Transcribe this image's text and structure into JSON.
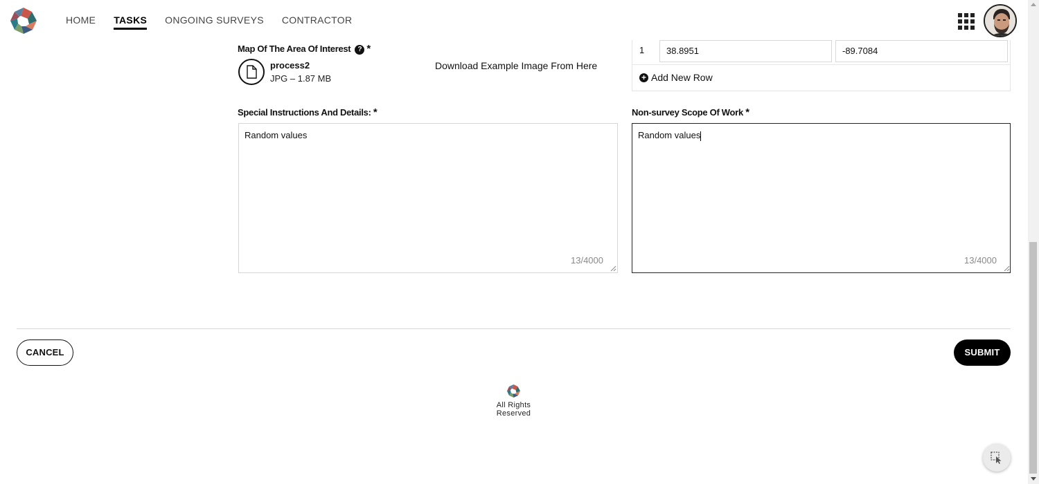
{
  "nav": {
    "items": [
      {
        "label": "HOME"
      },
      {
        "label": "TASKS"
      },
      {
        "label": "ONGOING SURVEYS"
      },
      {
        "label": "CONTRACTOR"
      }
    ],
    "active": "TASKS"
  },
  "map_section": {
    "label": "Map Of The Area Of Interest",
    "required_mark": "*",
    "help_icon": "question-circle-icon",
    "file": {
      "name": "process2",
      "meta": "JPG – 1.87 MB",
      "icon": "file-icon"
    },
    "download_link": "Download Example Image From Here"
  },
  "coordinates": {
    "rows": [
      {
        "index": "1",
        "latitude": "38.8951",
        "longitude": "-89.7084"
      }
    ],
    "add_row_label": "Add New Row"
  },
  "special_instructions": {
    "label": "Special Instructions And Details:",
    "required_mark": "*",
    "value": "Random values",
    "counter": "13/4000"
  },
  "non_survey_scope": {
    "label": "Non-survey Scope Of Work",
    "required_mark": "*",
    "value": "Random values",
    "counter": "13/4000"
  },
  "actions": {
    "cancel_label": "CANCEL",
    "submit_label": "SUBMIT"
  },
  "footer": {
    "text": "All Rights Reserved"
  },
  "colors": {
    "primary": "#000000",
    "border": "#d6d6d6",
    "muted_text": "#8a8a8a"
  }
}
